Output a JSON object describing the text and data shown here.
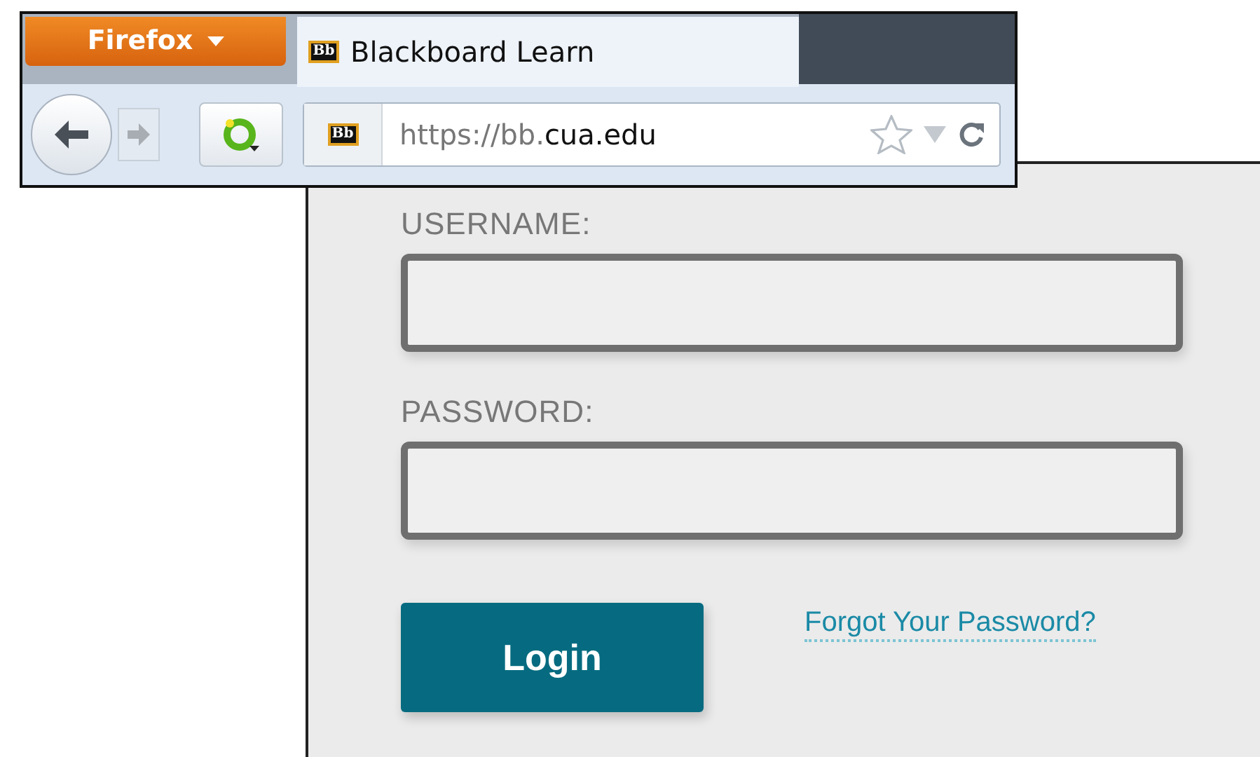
{
  "browser": {
    "menu_button": "Firefox",
    "tab": {
      "favicon": "Bb",
      "title": "Blackboard Learn",
      "selected": true
    },
    "address_bar": {
      "favicon": "Bb",
      "url_host_prefix": "https://bb.",
      "url_domain": "cua.edu"
    }
  },
  "login_form": {
    "fields": [
      {
        "label": "USERNAME:"
      },
      {
        "label": "PASSWORD:"
      }
    ],
    "login_button": "Login",
    "forgot_link": "Forgot Your Password?"
  }
}
